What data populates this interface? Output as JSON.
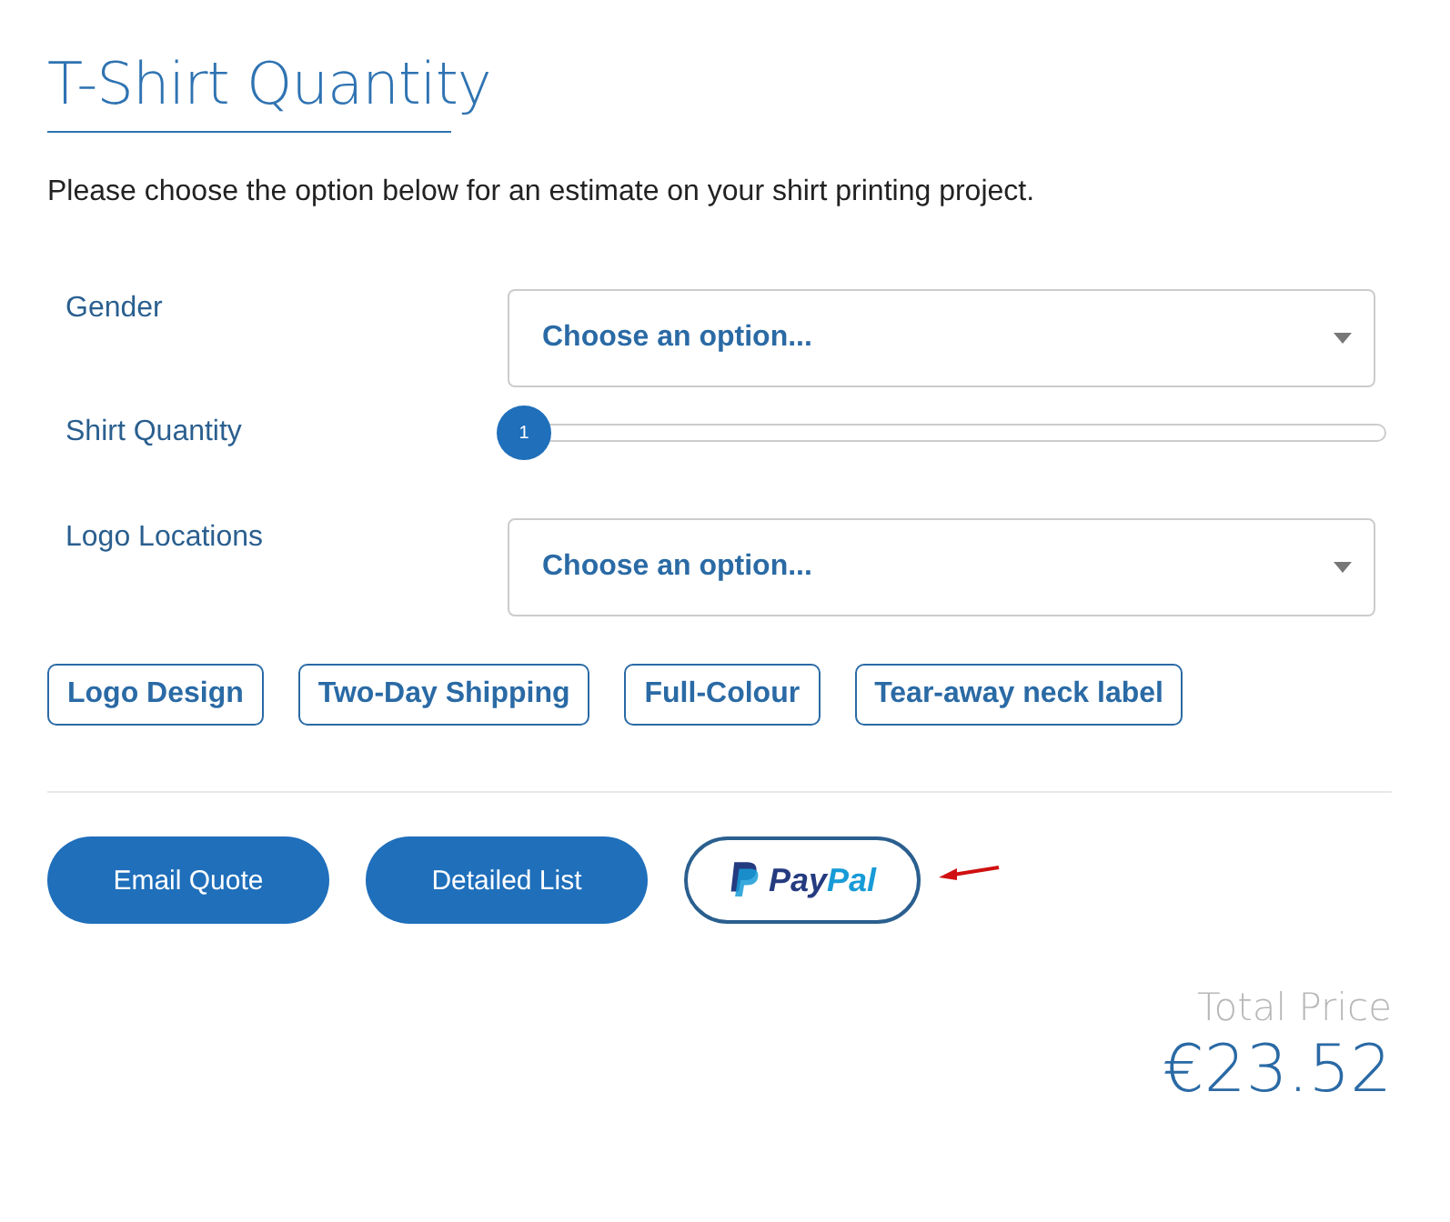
{
  "title": "T-Shirt Quantity",
  "intro": "Please choose the option below for an estimate on your shirt printing project.",
  "fields": [
    {
      "kind": "select",
      "label": "Gender",
      "placeholder": "Choose an option..."
    },
    {
      "kind": "slider",
      "label": "Shirt Quantity",
      "value": "1",
      "level": 0
    },
    {
      "kind": "select",
      "label": "Logo Locations",
      "placeholder": "Choose an option..."
    }
  ],
  "options": [
    "Logo Design",
    "Two-Day Shipping",
    "Full-Colour",
    "Tear-away neck label"
  ],
  "buttons": [
    {
      "kind": "primary",
      "label": "Email Quote"
    },
    {
      "kind": "primary",
      "label": "Detailed List"
    },
    {
      "kind": "paypal",
      "label_parts": [
        "Pay",
        "Pal"
      ]
    }
  ],
  "total": {
    "label": "Total Price",
    "amount": "€23.52"
  }
}
